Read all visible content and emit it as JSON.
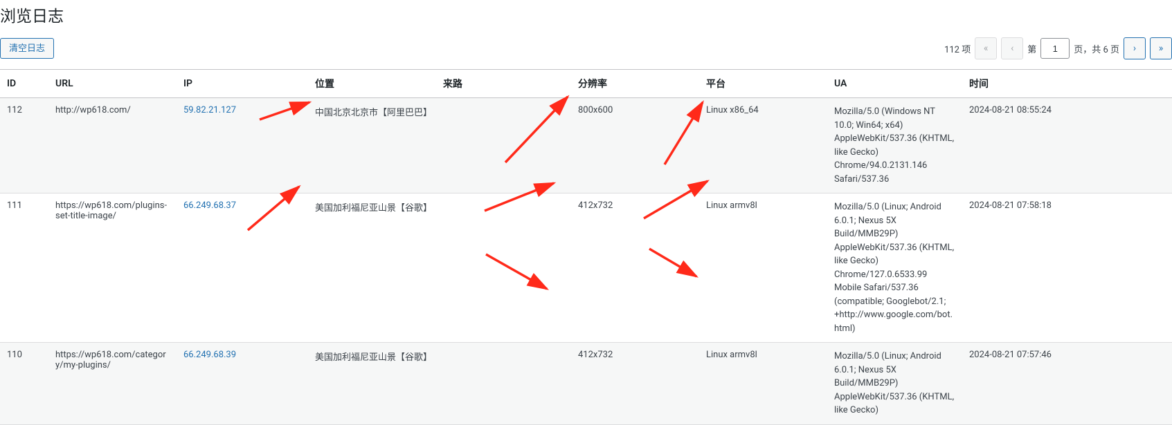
{
  "page_title": "浏览日志",
  "clear_button": "清空日志",
  "pagination": {
    "total_items_label": "112 项",
    "first": "«",
    "prev": "‹",
    "page_prefix": "第",
    "current_page": "1",
    "pages_suffix_label": "页，共 6 页",
    "next": "›",
    "last": "»"
  },
  "columns": {
    "id": "ID",
    "url": "URL",
    "ip": "IP",
    "location": "位置",
    "referer": "来路",
    "resolution": "分辨率",
    "platform": "平台",
    "ua": "UA",
    "time": "时间"
  },
  "rows": [
    {
      "id": "112",
      "url": "http://wp618.com/",
      "ip": "59.82.21.127",
      "location": "中国北京北京市【阿里巴巴】",
      "referer": "",
      "resolution": "800x600",
      "platform": "Linux x86_64",
      "ua": "Mozilla/5.0 (Windows NT 10.0; Win64; x64) AppleWebKit/537.36 (KHTML, like Gecko) Chrome/94.0.2131.146 Safari/537.36",
      "time": "2024-08-21 08:55:24"
    },
    {
      "id": "111",
      "url": "https://wp618.com/plugins-set-title-image/",
      "ip": "66.249.68.37",
      "location": "美国加利福尼亚山景【谷歌】",
      "referer": "",
      "resolution": "412x732",
      "platform": "Linux armv8l",
      "ua": "Mozilla/5.0 (Linux; Android 6.0.1; Nexus 5X Build/MMB29P) AppleWebKit/537.36 (KHTML, like Gecko) Chrome/127.0.6533.99 Mobile Safari/537.36 (compatible; Googlebot/2.1; +http://www.google.com/bot.html)",
      "time": "2024-08-21 07:58:18"
    },
    {
      "id": "110",
      "url": "https://wp618.com/category/my-plugins/",
      "ip": "66.249.68.39",
      "location": "美国加利福尼亚山景【谷歌】",
      "referer": "",
      "resolution": "412x732",
      "platform": "Linux armv8l",
      "ua": "Mozilla/5.0 (Linux; Android 6.0.1; Nexus 5X Build/MMB29P) AppleWebKit/537.36 (KHTML, like Gecko)",
      "time": "2024-08-21 07:57:46"
    }
  ]
}
